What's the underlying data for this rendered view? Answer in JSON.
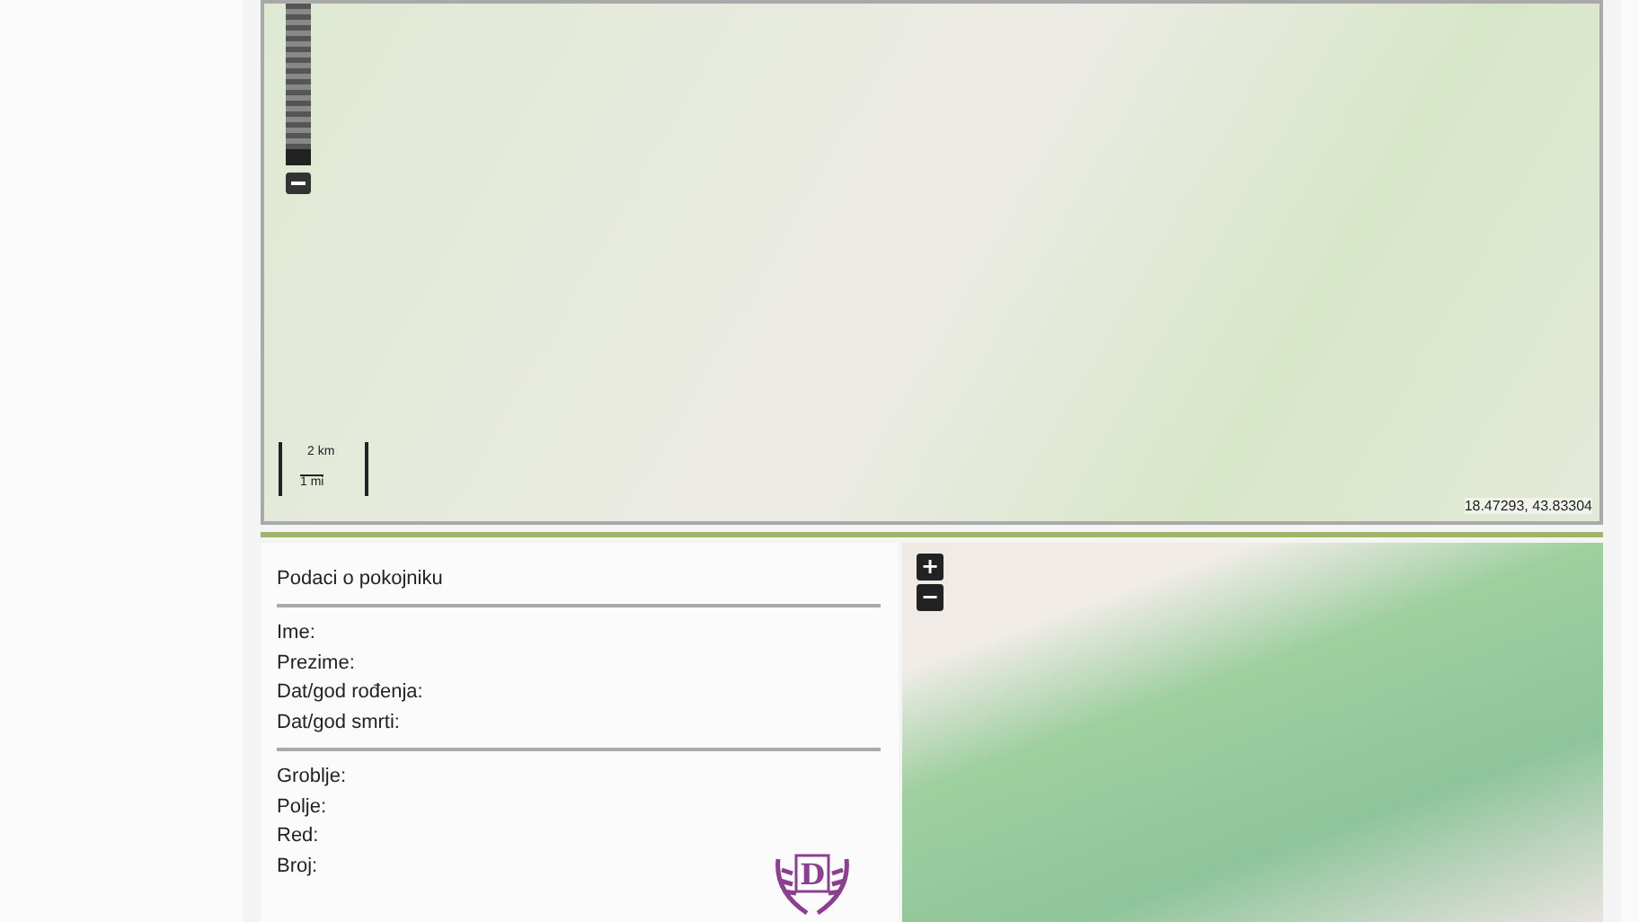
{
  "overview_map": {
    "scale_bar": {
      "metric": "2 km",
      "imperial": "1 mi"
    },
    "coordinates": "18.47293, 43.83304",
    "zoom_slider": {
      "level": 0.1
    }
  },
  "deceased_panel": {
    "title": "Podaci o pokojniku",
    "person_fields": [
      {
        "label": "Ime:"
      },
      {
        "label": "Prezime:"
      },
      {
        "label": "Dat/god rođenja:"
      },
      {
        "label": "Dat/god smrti:"
      }
    ],
    "grave_fields": [
      {
        "label": "Groblje:"
      },
      {
        "label": "Polje:"
      },
      {
        "label": "Red:"
      },
      {
        "label": "Broj:"
      }
    ],
    "logo_letter": "D"
  },
  "cemetery_map": {
    "zoom_in": "+",
    "zoom_out": "−"
  }
}
